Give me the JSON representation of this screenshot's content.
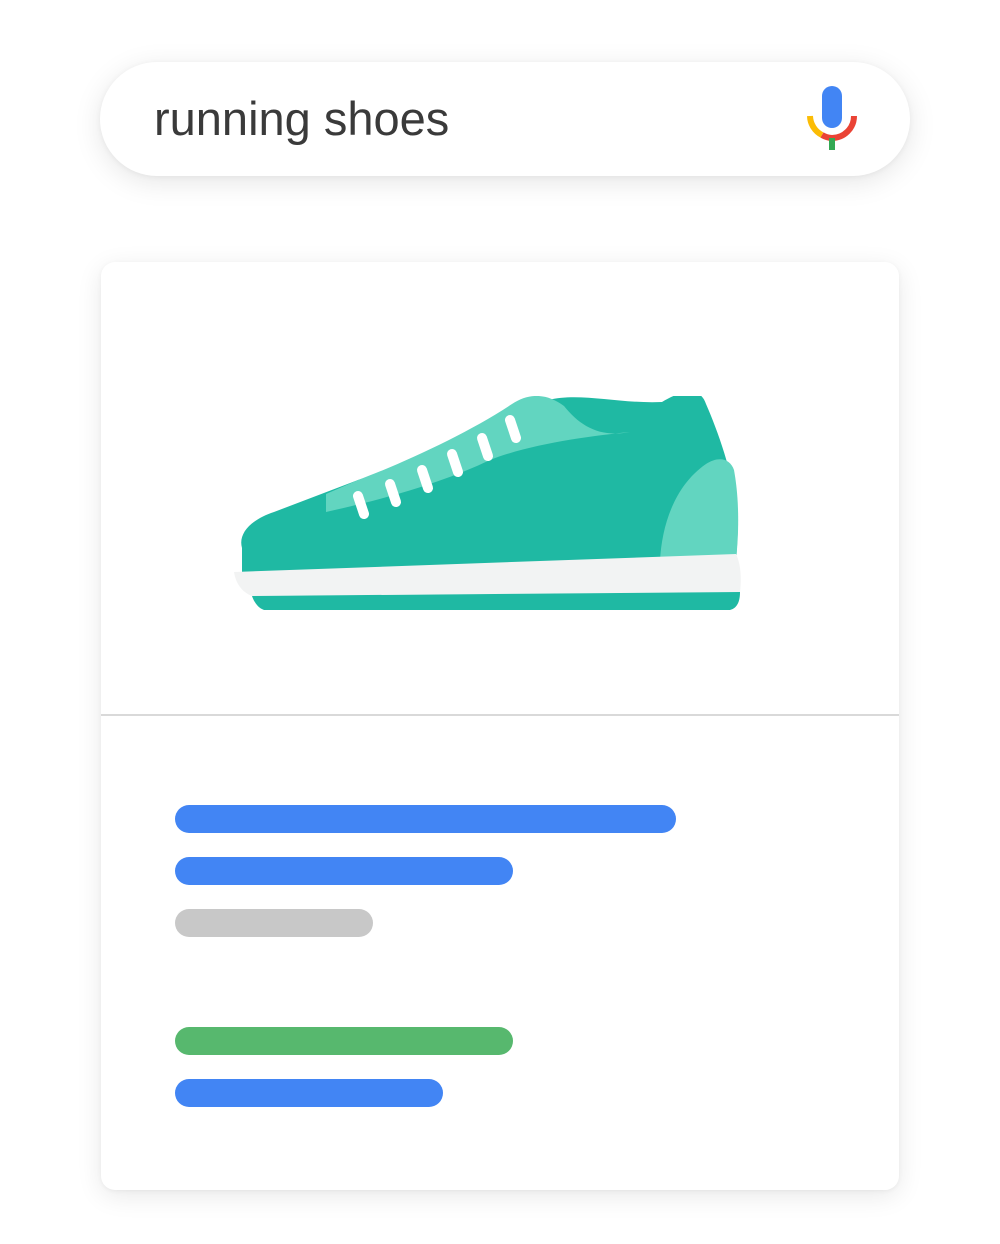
{
  "search": {
    "query": "running shoes",
    "mic_icon": "microphone-icon"
  },
  "result_card": {
    "image_icon": "running-shoe-icon",
    "placeholder_lines": [
      {
        "role": "title-line",
        "color": "#4285f4"
      },
      {
        "role": "title-line",
        "color": "#4285f4"
      },
      {
        "role": "meta-line",
        "color": "#c8c8c8"
      },
      {
        "role": "price-line",
        "color": "#57b86e"
      },
      {
        "role": "link-line",
        "color": "#4285f4"
      }
    ]
  },
  "colors": {
    "blue": "#4285f4",
    "green": "#57b86e",
    "gray": "#c8c8c8",
    "shoe_dark": "#1fb9a3",
    "shoe_light": "#62d5c0",
    "sole": "#f2f3f3"
  }
}
